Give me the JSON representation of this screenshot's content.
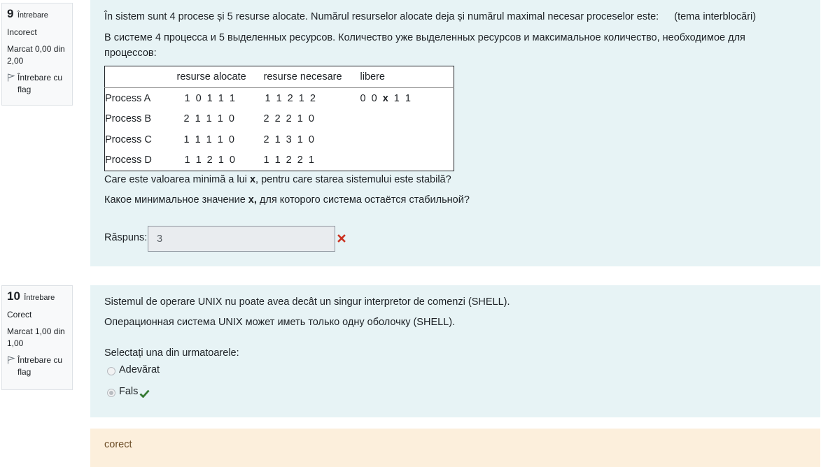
{
  "q9": {
    "number": "9",
    "word": "Întrebare",
    "status": "Incorect",
    "mark_line1": "Marcat 0,00 din",
    "mark_line2": "2,00",
    "flag_line1": "Întrebare cu",
    "flag_line2": "flag",
    "text_ro": "În sistem sunt 4 procese și 5 resurse alocate. Numărul resurselor alocate deja și numărul maximal necesar proceselor este:",
    "topic": "(tema interblocări)",
    "text_ru_line1": "В системе 4 процесса и 5 выделенных ресурсов. Количество уже выделенных ресурсов и максимальное количество, необходимое для",
    "text_ru_line2": "процессов:",
    "table": {
      "headers": [
        "",
        "resurse alocate",
        "resurse necesare",
        "libere"
      ],
      "rows": [
        {
          "name": "Process A",
          "alocate": "1 0 1 1 1",
          "necesare": "1 1 2 1 2",
          "libere_pre": "0 0 ",
          "libere_x": "x",
          "libere_post": " 1 1"
        },
        {
          "name": "Process B",
          "alocate": "2 1 1 1 0",
          "necesare": "2 2 2 1 0",
          "libere_pre": "",
          "libere_x": "",
          "libere_post": ""
        },
        {
          "name": "Process C",
          "alocate": "1 1 1 1 0",
          "necesare": "2 1 3 1 0",
          "libere_pre": "",
          "libere_x": "",
          "libere_post": ""
        },
        {
          "name": "Process D",
          "alocate": "1 1 2 1 0",
          "necesare": "1 1 2 2 1",
          "libere_pre": "",
          "libere_x": "",
          "libere_post": ""
        }
      ]
    },
    "question_ro_pre": "Care este valoarea minimă a lui ",
    "question_ro_x": "x",
    "question_ro_post": ", pentru care starea sistemului este stabilă?",
    "question_ru_pre": "Какое минимальное значение ",
    "question_ru_x": "x,",
    "question_ru_post": " для которого система остаётся стабильной?",
    "answer_label": "Răspuns:",
    "answer_value": "3"
  },
  "q10": {
    "number": "10",
    "word": "Întrebare",
    "status": "Corect",
    "mark_line1": "Marcat 1,00 din",
    "mark_line2": "1,00",
    "flag_line1": "Întrebare cu",
    "flag_line2": "flag",
    "text_ro": "Sistemul de operare UNIX nu poate avea decât un singur interpretor de comenzi (SHELL).",
    "text_ru": "Операционная система UNIX может иметь только одну оболочку (SHELL).",
    "prompt": "Selectați una din urmatoarele:",
    "options": [
      {
        "label": "Adevărat",
        "selected": false
      },
      {
        "label": "Fals",
        "selected": true
      }
    ]
  },
  "feedback": "corect",
  "colors": {
    "content_bg": "#e7f3f5",
    "feedback_bg": "#fcefdc",
    "incorrect": "#ca3120",
    "correct": "#357a32"
  }
}
